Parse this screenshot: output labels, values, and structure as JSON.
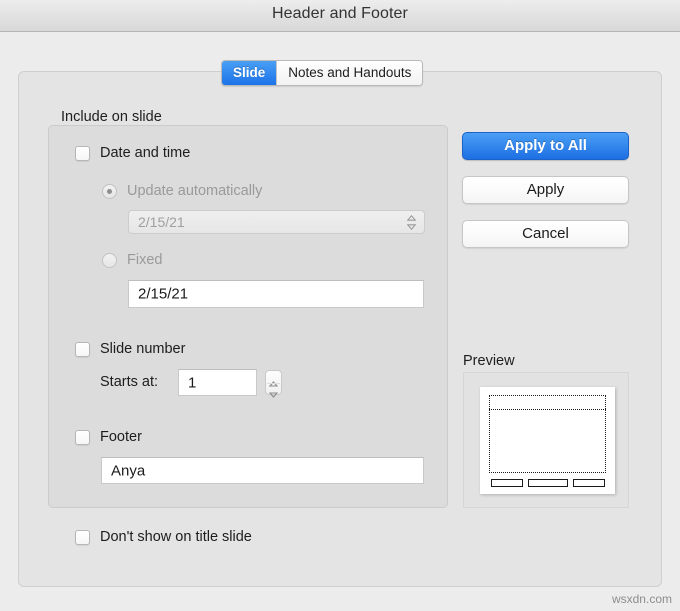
{
  "window": {
    "title": "Header and Footer"
  },
  "tabs": [
    {
      "label": "Slide",
      "active": true
    },
    {
      "label": "Notes and Handouts",
      "active": false
    }
  ],
  "group": {
    "title": "Include on slide",
    "date_and_time": {
      "label": "Date and time",
      "checked": false,
      "update_automatically": {
        "label": "Update automatically",
        "selected": true,
        "enabled": false,
        "value": "2/15/21"
      },
      "fixed": {
        "label": "Fixed",
        "selected": false,
        "enabled": false,
        "value": "2/15/21"
      }
    },
    "slide_number": {
      "label": "Slide number",
      "checked": false,
      "starts_at_label": "Starts at:",
      "starts_at_value": "1"
    },
    "footer": {
      "label": "Footer",
      "checked": false,
      "value": "Anya"
    }
  },
  "dont_show_on_title_slide": {
    "label": "Don't show on title slide",
    "checked": false
  },
  "buttons": {
    "apply_to_all": "Apply to All",
    "apply": "Apply",
    "cancel": "Cancel"
  },
  "preview": {
    "label": "Preview"
  },
  "watermark": "wsxdn.com",
  "colors": {
    "accent_blue": "#1d6fe3",
    "tab_active_blue": "#1b73e8",
    "window_bg": "#ececec",
    "panel_bg": "#e4e4e4",
    "group_bg": "#dcdcdc",
    "edge_strip": "#3b9cc4",
    "disabled_text": "#9a9a9a",
    "text": "#1d1d1d"
  }
}
